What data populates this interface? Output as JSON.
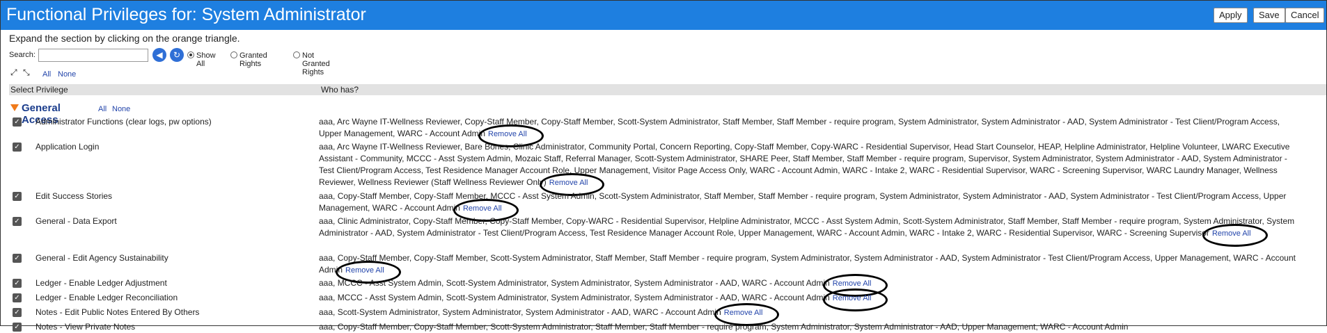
{
  "header": {
    "title": "Functional Privileges for: System Administrator",
    "apply": "Apply",
    "save": "Save",
    "cancel": "Cancel"
  },
  "hint": "Expand the section by clicking on the orange triangle.",
  "search": {
    "label": "Search:",
    "value": "",
    "placeholder": "",
    "options": [
      "Show All",
      "Granted Rights",
      "Not Granted Rights"
    ],
    "selected": "Show All"
  },
  "tools": {
    "all": "All",
    "none": "None"
  },
  "columns": {
    "privilege": "Select Privilege",
    "who": "Who has?"
  },
  "section": {
    "title": "General Access",
    "all": "All",
    "none": "None"
  },
  "remove_label": "Remove All",
  "rows": [
    {
      "name": "Administrator Functions (clear logs, pw options)",
      "who": "aaa, Arc Wayne IT-Wellness Reviewer, Copy-Staff Member, Copy-Staff Member, Scott-System Administrator, Staff Member, Staff Member - require program, System Administrator, System Administrator - AAD, System Administrator - Test Client/Program Access, Upper Management, WARC - Account Admin"
    },
    {
      "name": "Application Login",
      "who": "aaa, Arc Wayne IT-Wellness Reviewer, Bare Bones, Clinic Administrator, Community Portal, Concern Reporting, Copy-Staff Member, Copy-WARC - Residential Supervisor, Head Start Counselor, HEAP, Helpline Administrator, Helpline Volunteer, LWARC Executive Assistant - Community, MCCC - Asst System Admin, Mozaic Staff, Referral Manager, Scott-System Administrator, SHARE Peer, Staff Member, Staff Member - require program, Supervisor, System Administrator, System Administrator - AAD, System Administrator - Test Client/Program Access, Test Residence Manager Account Role, Upper Management, Visitor Page Access Only, WARC - Account Admin, WARC - Intake 2, WARC - Residential Supervisor, WARC - Screening Supervisor, WARC Laundry Manager, Wellness Reviewer, Wellness Reviewer (Staff Wellness Reviewer Only)"
    },
    {
      "name": "Edit Success Stories",
      "who": "aaa, Copy-Staff Member, Copy-Staff Member, MCCC - Asst System Admin, Scott-System Administrator, Staff Member, Staff Member - require program, System Administrator, System Administrator - AAD, System Administrator - Test Client/Program Access, Upper Management, WARC - Account Admin"
    },
    {
      "name": "General - Data Export",
      "who": "aaa, Clinic Administrator, Copy-Staff Member, Copy-Staff Member, Copy-WARC - Residential Supervisor, Helpline Administrator, MCCC - Asst System Admin, Scott-System Administrator, Staff Member, Staff Member - require program, System Administrator, System Administrator - AAD, System Administrator - Test Client/Program Access, Test Residence Manager Account Role, Upper Management, WARC - Account Admin, WARC - Intake 2, WARC - Residential Supervisor, WARC - Screening Supervisor"
    },
    {
      "name": "General - Edit Agency Sustainability",
      "who": "aaa, Copy-Staff Member, Copy-Staff Member, Scott-System Administrator, Staff Member, Staff Member - require program, System Administrator, System Administrator - AAD, System Administrator - Test Client/Program Access, Upper Management, WARC - Account Admin"
    },
    {
      "name": "Ledger - Enable Ledger Adjustment",
      "who": "aaa, MCCC - Asst System Admin, Scott-System Administrator, System Administrator, System Administrator - AAD, WARC - Account Admin"
    },
    {
      "name": "Ledger - Enable Ledger Reconciliation",
      "who": "aaa, MCCC - Asst System Admin, Scott-System Administrator, System Administrator, System Administrator - AAD, WARC - Account Admin"
    },
    {
      "name": "Notes - Edit Public Notes Entered By Others",
      "who": "aaa, Scott-System Administrator, System Administrator, System Administrator - AAD, WARC - Account Admin"
    },
    {
      "name": "Notes - View Private Notes",
      "who": "aaa, Copy-Staff Member, Copy-Staff Member, Scott-System Administrator, Staff Member, Staff Member - require program, System Administrator, System Administrator - AAD, Upper Management, WARC - Account Admin"
    }
  ]
}
